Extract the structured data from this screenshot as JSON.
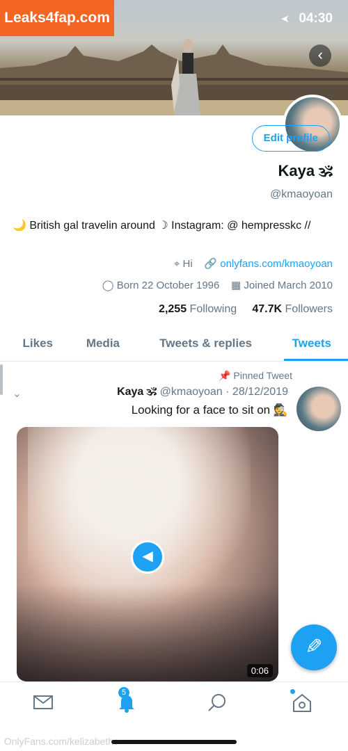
{
  "watermark_logo": "Leaks4fap.com",
  "status": {
    "time": "04:30"
  },
  "profile": {
    "edit_label": "Edit profile",
    "name": "Kaya 🕉",
    "handle": "@kmaoyoan",
    "bio": "🌙 British gal travelin around ☽ Instagram: @ hempresskc //",
    "location": "Hi",
    "website": "onlyfans.com/kmaoyoan",
    "born": "Born 22 October 1996",
    "joined": "Joined March 2010",
    "following_count": "2,255",
    "following_label": "Following",
    "followers_count": "47.7K",
    "followers_label": "Followers"
  },
  "tabs": [
    "Tweets",
    "Tweets & replies",
    "Media",
    "Likes"
  ],
  "tweet": {
    "pinned_label": "Pinned Tweet",
    "name": "Kaya 🕉",
    "meta": "@kmaoyoan · 28/12/2019",
    "text": "Looking for a face to sit on 🕵",
    "duration": "0:06"
  },
  "nav": {
    "notifications_badge": "5"
  },
  "footer_watermark": "OnlyFans.com/kelizabethc",
  "colors": {
    "accent": "#1da1f2",
    "logo_bg": "#f26522"
  }
}
